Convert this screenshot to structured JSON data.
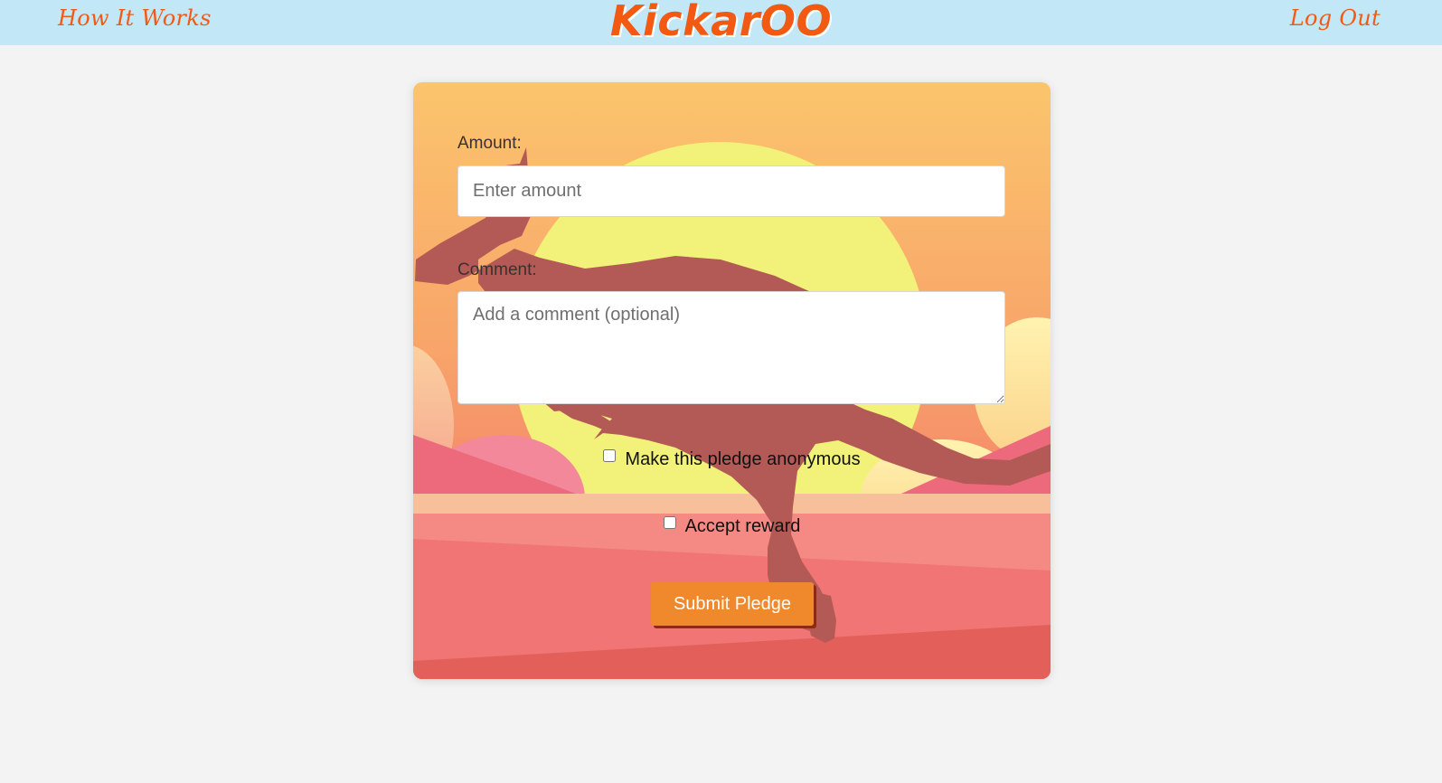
{
  "nav": {
    "how_it_works": "How It Works",
    "brand": "KickarOO",
    "log_out": "Log Out"
  },
  "form": {
    "amount_label": "Amount:",
    "amount_placeholder": "Enter amount",
    "comment_label": "Comment:",
    "comment_placeholder": "Add a comment (optional)",
    "anonymous_label": "Make this pledge anonymous",
    "reward_label": "Accept reward",
    "submit_label": "Submit Pledge"
  },
  "colors": {
    "accent": "#f25a14",
    "nav_bg": "#c2e8f8",
    "button": "#f0892b",
    "page_bg": "#f3f3f3"
  }
}
